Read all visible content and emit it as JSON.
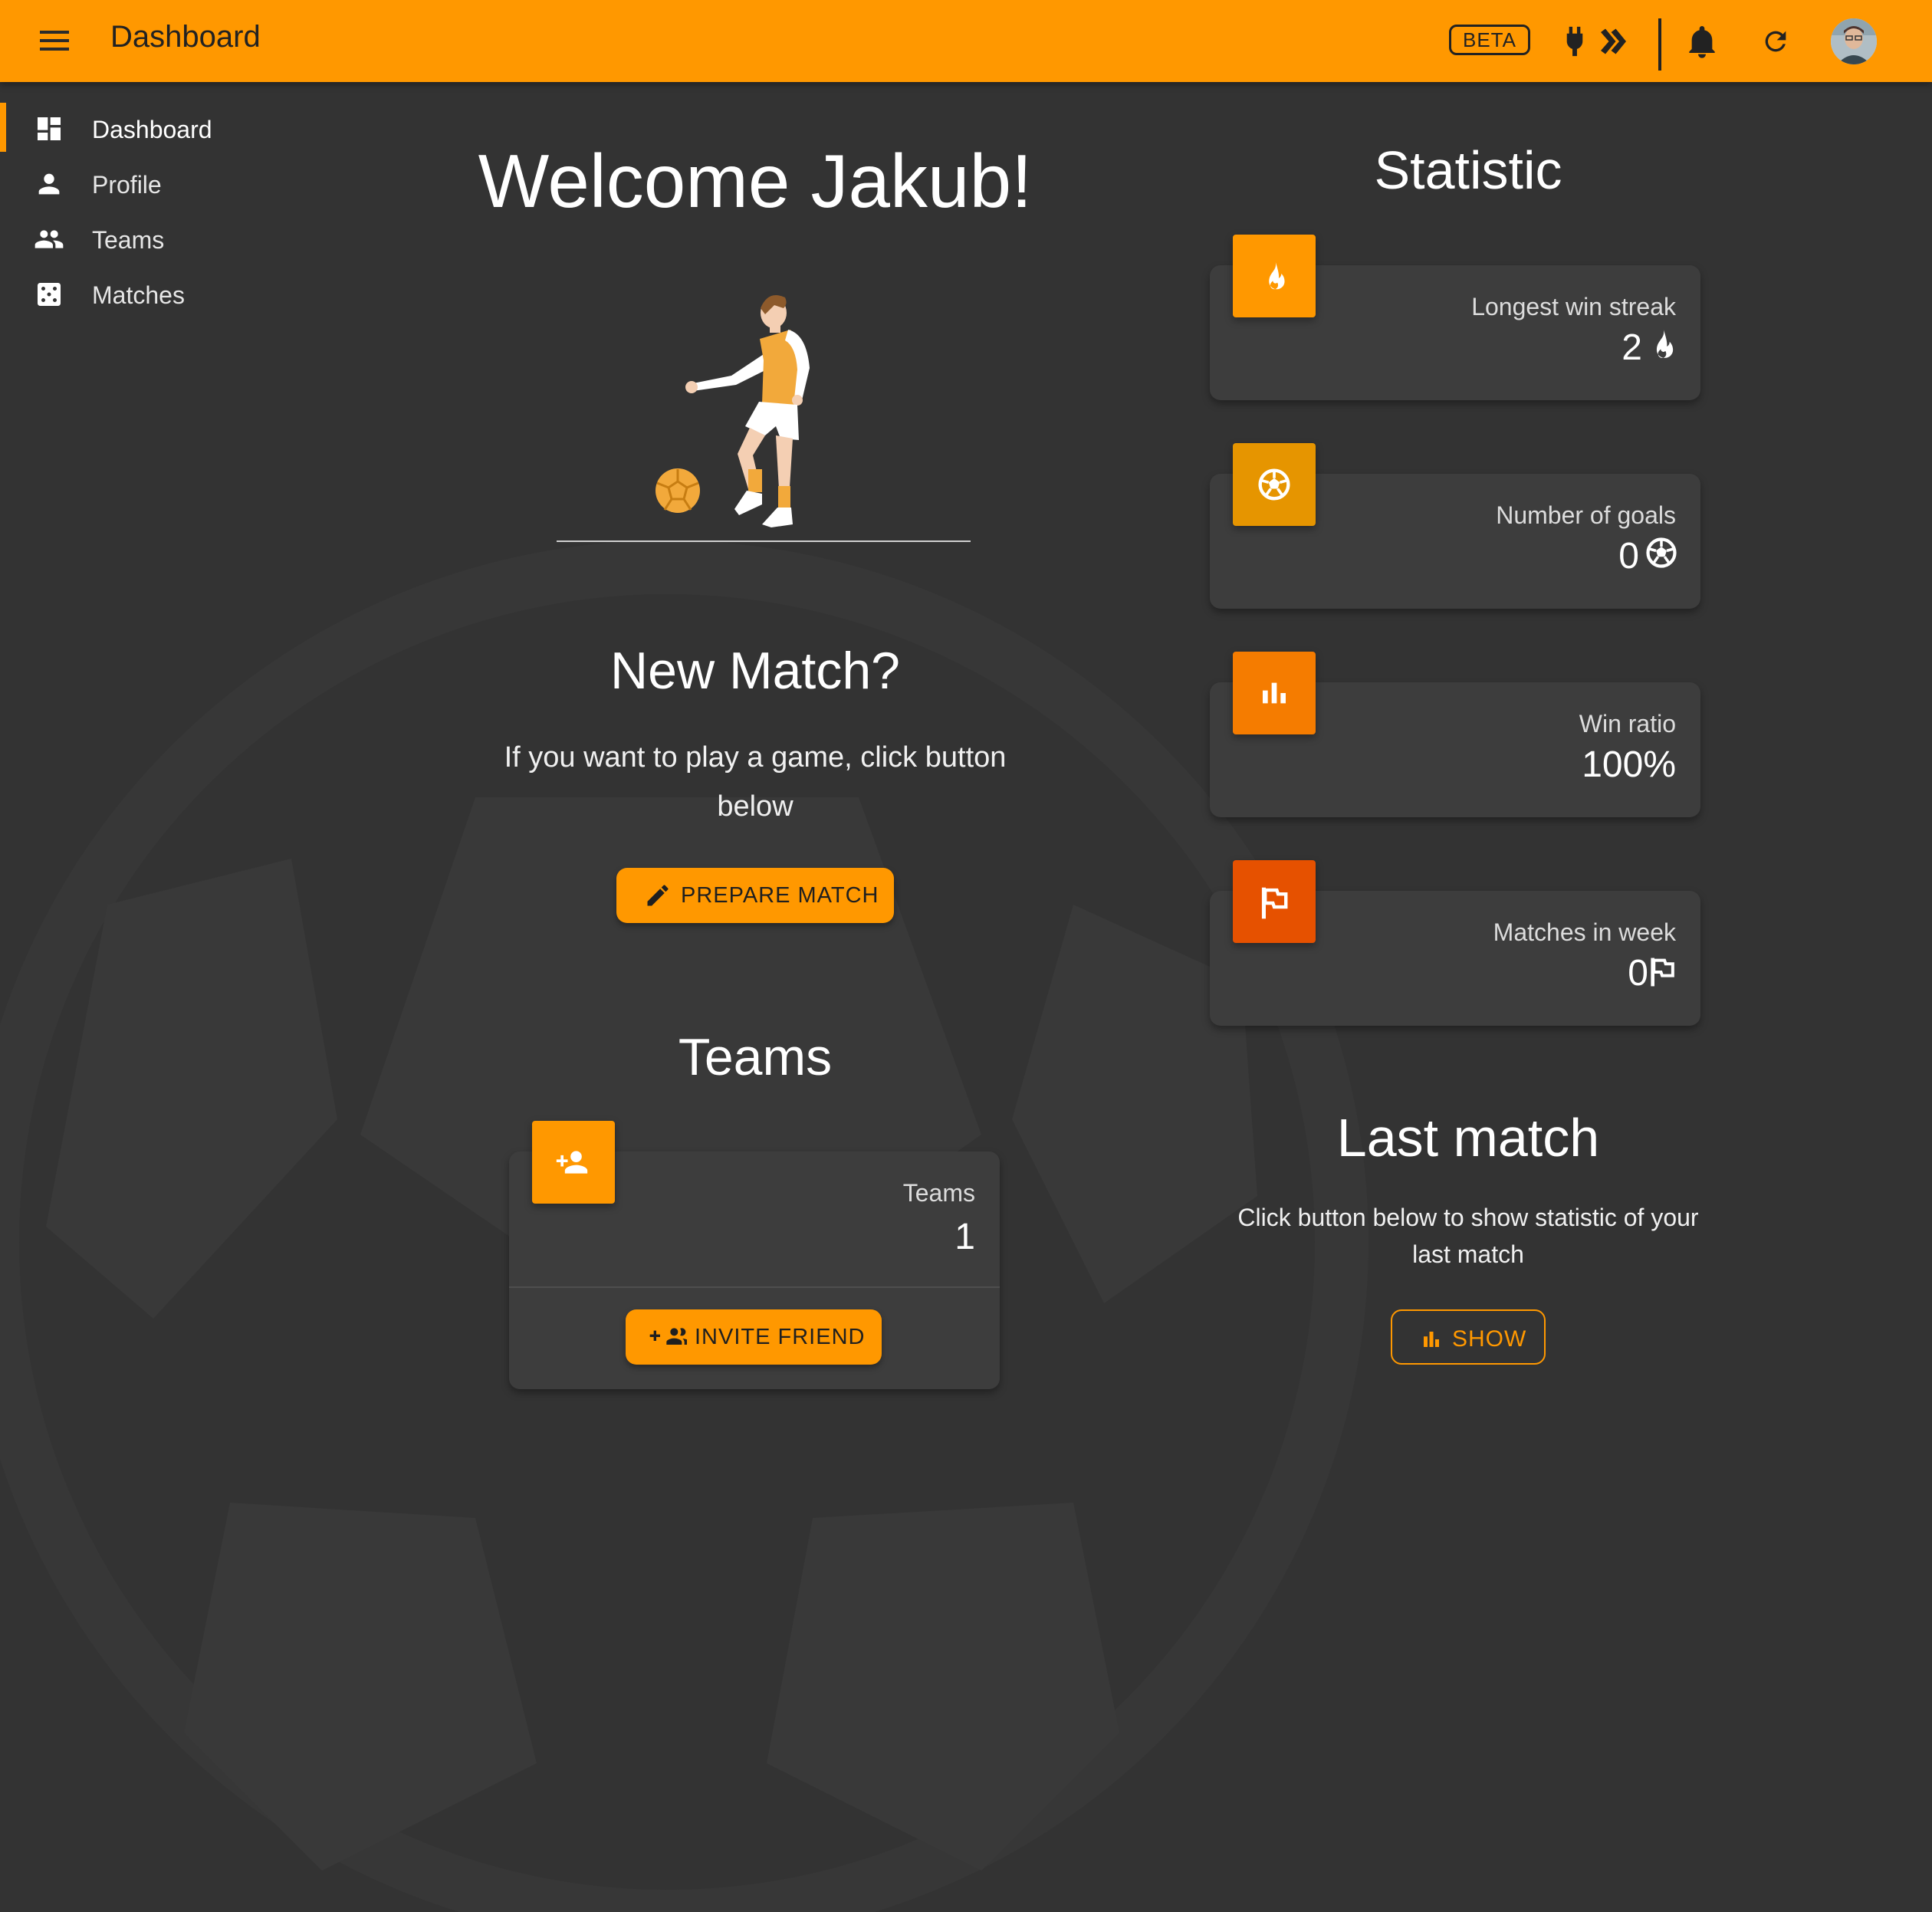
{
  "header": {
    "title": "Dashboard",
    "beta_label": "BETA",
    "accent_color": "#ff9800",
    "icons": [
      "menu-icon",
      "plug-icon",
      "double-chevron-right-icon",
      "bell-icon",
      "refresh-icon",
      "avatar"
    ]
  },
  "sidebar": {
    "items": [
      {
        "label": "Dashboard",
        "icon": "dashboard-icon",
        "active": true
      },
      {
        "label": "Profile",
        "icon": "person-icon",
        "active": false
      },
      {
        "label": "Teams",
        "icon": "people-icon",
        "active": false
      },
      {
        "label": "Matches",
        "icon": "dice-icon",
        "active": false
      }
    ]
  },
  "main": {
    "welcome": "Welcome Jakub!",
    "new_match": {
      "title": "New Match?",
      "text": "If you want to play a game, click button below",
      "button_label": "PREPARE MATCH",
      "button_icon": "pencil-icon"
    },
    "teams": {
      "title": "Teams",
      "card_label": "Teams",
      "card_value": "1",
      "card_icon": "person-add-icon",
      "button_label": "INVITE FRIEND",
      "button_icon": "group-add-icon"
    }
  },
  "statistic": {
    "title": "Statistic",
    "cards": [
      {
        "label": "Longest win streak",
        "value": "2",
        "icon": "fire-icon",
        "color": "#ff9800"
      },
      {
        "label": "Number of goals",
        "value": "0",
        "icon": "soccer-ball-icon",
        "color": "#e69500"
      },
      {
        "label": "Win ratio",
        "value": "100%",
        "icon": "bar-chart-icon",
        "color": "#f57c00"
      },
      {
        "label": "Matches in week",
        "value": "0",
        "icon": "flag-icon",
        "color": "#e65100"
      }
    ]
  },
  "last_match": {
    "title": "Last match",
    "text": "Click button below to show statistic of your last match",
    "button_label": "SHOW",
    "button_icon": "bar-chart-icon"
  }
}
